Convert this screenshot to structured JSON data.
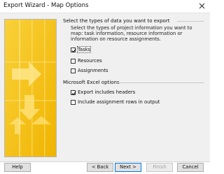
{
  "window": {
    "title": "Export Wizard - Map Options"
  },
  "sections": {
    "data_types": {
      "heading": "Select the types of data you want to export",
      "description": "Select the types of project information you want to map: task information, resource information or information on resource assignments.",
      "options": [
        {
          "label": "Tasks",
          "checked": true
        },
        {
          "label": "Resources",
          "checked": false
        },
        {
          "label": "Assignments",
          "checked": false
        }
      ]
    },
    "excel_options": {
      "heading": "Microsoft Excel options",
      "options": [
        {
          "label": "Export includes headers",
          "checked": true
        },
        {
          "label": "Include assignment rows in output",
          "checked": false
        }
      ]
    }
  },
  "buttons": {
    "help": "Help",
    "back": "< Back",
    "next": "Next >",
    "finish": "Finish",
    "cancel": "Cancel"
  },
  "colors": {
    "banner_gold": "#f5c518",
    "banner_light": "#ffe27a",
    "accent_blue": "#0078d7",
    "dialog_background": "#f0f0f0"
  },
  "icons": {
    "close": "close-icon",
    "banner": "wizard-banner-arrows-icon"
  }
}
